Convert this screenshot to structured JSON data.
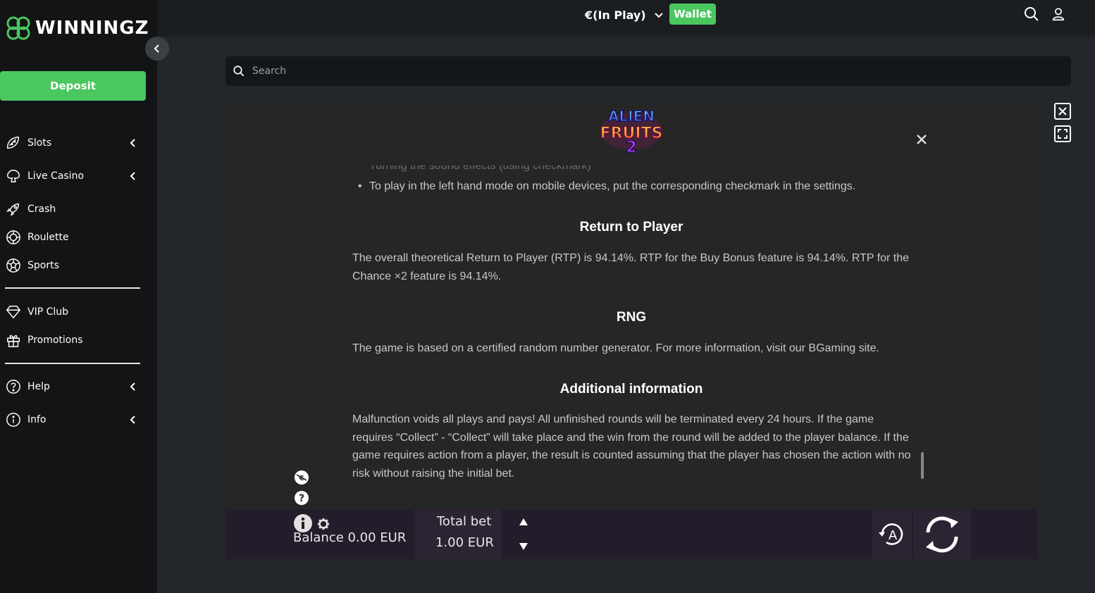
{
  "brand": {
    "name": "WINNINGZ",
    "accent": "#4bc760"
  },
  "sidebar": {
    "deposit_label": "Deposit",
    "items": [
      {
        "label": "Slots",
        "icon": "slots-icon",
        "has_chevron": true
      },
      {
        "label": "Live Casino",
        "icon": "live-casino-icon",
        "has_chevron": true
      },
      {
        "label": "Crash",
        "icon": "rocket-icon",
        "has_chevron": false
      },
      {
        "label": "Roulette",
        "icon": "roulette-icon",
        "has_chevron": false
      },
      {
        "label": "Sports",
        "icon": "soccer-ball-icon",
        "has_chevron": false
      },
      {
        "label": "VIP Club",
        "icon": "diamond-icon",
        "has_chevron": false
      },
      {
        "label": "Promotions",
        "icon": "gift-icon",
        "has_chevron": false
      },
      {
        "label": "Help",
        "icon": "help-icon",
        "has_chevron": true
      },
      {
        "label": "Info",
        "icon": "info-icon",
        "has_chevron": true
      }
    ]
  },
  "header": {
    "balance_selector": "€(In Play)",
    "wallet_label": "Wallet"
  },
  "search": {
    "placeholder": "Search"
  },
  "game": {
    "title_logo": "ALIEN FRUITS 2",
    "rules": {
      "bullet_partial": "Turning the sound effects (using checkmark)",
      "bullet_2": "To play in the left hand mode on mobile devices, put the corresponding checkmark in the settings.",
      "rtp_heading": "Return to Player",
      "rtp_text": "The overall theoretical Return to Player (RTP) is 94.14%. RTP for the Buy Bonus feature is 94.14%. RTP for the Chance ×2 feature is 94.14%.",
      "rng_heading": "RNG",
      "rng_text": "The game is based on a certified random number generator. For more information, visit our BGaming site.",
      "add_heading": "Additional information",
      "add_text": "Malfunction voids all plays and pays! All unfinished rounds will be terminated every 24 hours. If the game requires “Collect” - “Collect” will take place and the win from the round will be added to the player balance. If the game requires action from a player, the result is counted assuming that the player has chosen the action with no risk without raising the initial bet."
    },
    "controls": {
      "balance_label": "Balance 0.00 EUR",
      "total_bet_label": "Total bet",
      "total_bet_value": "1.00 EUR",
      "auto_label": "A"
    }
  }
}
